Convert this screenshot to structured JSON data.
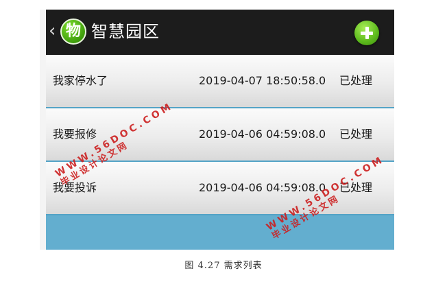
{
  "header": {
    "back_icon": "chevron-left-icon",
    "logo_char": "物",
    "title": "智慧园区",
    "add_icon": "plus-icon"
  },
  "requests": [
    {
      "title": "我家停水了",
      "time": "2019-04-07 18:50:58.0",
      "status": "已处理"
    },
    {
      "title": "我要报修",
      "time": "2019-04-06 04:59:08.0",
      "status": "已处理"
    },
    {
      "title": "我要投诉",
      "time": "2019-04-06 04:59:08.0",
      "status": "已处理"
    }
  ],
  "caption": "图 4.27 需求列表",
  "watermark": {
    "url": "WWW.56DOC.COM",
    "text": "毕业设计论文网"
  },
  "colors": {
    "titlebar": "#1c1c1c",
    "accent": "#63aecf",
    "watermark": "#cc1f1f",
    "add_button": "#5cb91c"
  }
}
